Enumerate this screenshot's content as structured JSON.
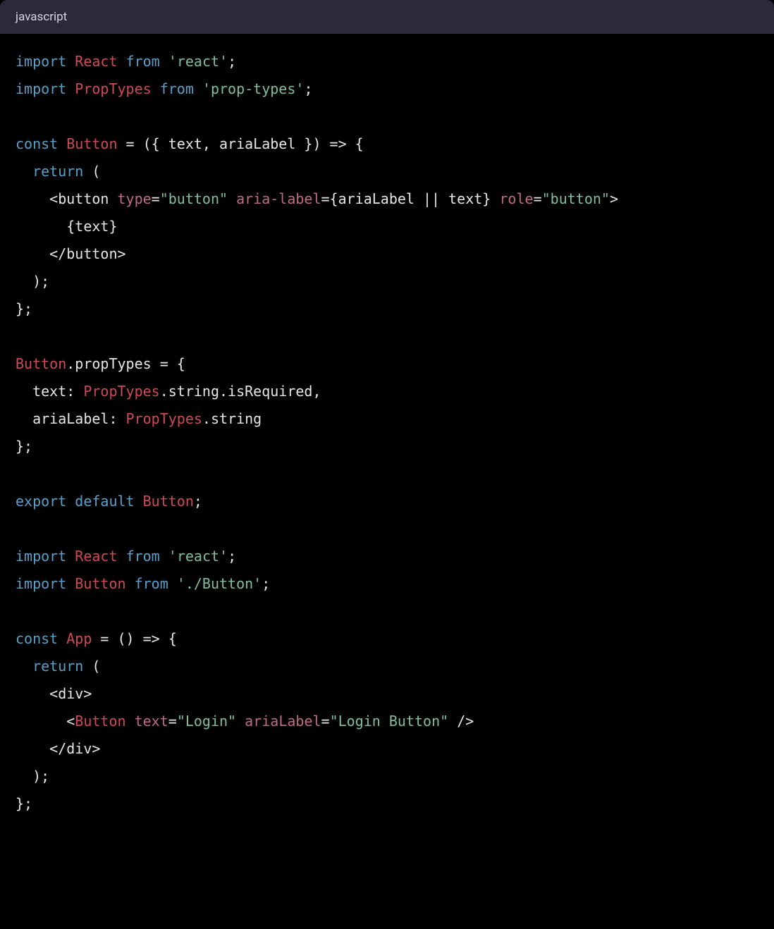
{
  "header": {
    "language": "javascript"
  },
  "code": {
    "lines": [
      [
        {
          "t": "import ",
          "c": "tok-kw"
        },
        {
          "t": "React",
          "c": "tok-type"
        },
        {
          "t": " ",
          "c": "tok-plain"
        },
        {
          "t": "from",
          "c": "tok-kw"
        },
        {
          "t": " ",
          "c": "tok-plain"
        },
        {
          "t": "'react'",
          "c": "tok-str"
        },
        {
          "t": ";",
          "c": "tok-punc"
        }
      ],
      [
        {
          "t": "import ",
          "c": "tok-kw"
        },
        {
          "t": "PropTypes",
          "c": "tok-type"
        },
        {
          "t": " ",
          "c": "tok-plain"
        },
        {
          "t": "from",
          "c": "tok-kw"
        },
        {
          "t": " ",
          "c": "tok-plain"
        },
        {
          "t": "'prop-types'",
          "c": "tok-str"
        },
        {
          "t": ";",
          "c": "tok-punc"
        }
      ],
      [],
      [
        {
          "t": "const ",
          "c": "tok-kw"
        },
        {
          "t": "Button",
          "c": "tok-type"
        },
        {
          "t": " = ({ text, ariaLabel }) => {",
          "c": "tok-plain"
        }
      ],
      [
        {
          "t": "  ",
          "c": "tok-plain"
        },
        {
          "t": "return",
          "c": "tok-kw"
        },
        {
          "t": " (",
          "c": "tok-plain"
        }
      ],
      [
        {
          "t": "    <button ",
          "c": "tok-plain"
        },
        {
          "t": "type",
          "c": "tok-attr"
        },
        {
          "t": "=",
          "c": "tok-plain"
        },
        {
          "t": "\"button\"",
          "c": "tok-str"
        },
        {
          "t": " ",
          "c": "tok-plain"
        },
        {
          "t": "aria-label",
          "c": "tok-attr"
        },
        {
          "t": "={ariaLabel || text} ",
          "c": "tok-plain"
        },
        {
          "t": "role",
          "c": "tok-attr"
        },
        {
          "t": "=",
          "c": "tok-plain"
        },
        {
          "t": "\"button\"",
          "c": "tok-str"
        },
        {
          "t": ">",
          "c": "tok-plain"
        }
      ],
      [
        {
          "t": "      {text}",
          "c": "tok-plain"
        }
      ],
      [
        {
          "t": "    </button>",
          "c": "tok-plain"
        }
      ],
      [
        {
          "t": "  );",
          "c": "tok-plain"
        }
      ],
      [
        {
          "t": "};",
          "c": "tok-plain"
        }
      ],
      [],
      [
        {
          "t": "Button",
          "c": "tok-type"
        },
        {
          "t": ".propTypes = {",
          "c": "tok-plain"
        }
      ],
      [
        {
          "t": "  text: ",
          "c": "tok-plain"
        },
        {
          "t": "PropTypes",
          "c": "tok-type"
        },
        {
          "t": ".string.isRequired,",
          "c": "tok-plain"
        }
      ],
      [
        {
          "t": "  ariaLabel: ",
          "c": "tok-plain"
        },
        {
          "t": "PropTypes",
          "c": "tok-type"
        },
        {
          "t": ".string",
          "c": "tok-plain"
        }
      ],
      [
        {
          "t": "};",
          "c": "tok-plain"
        }
      ],
      [],
      [
        {
          "t": "export default ",
          "c": "tok-kw"
        },
        {
          "t": "Button",
          "c": "tok-type"
        },
        {
          "t": ";",
          "c": "tok-punc"
        }
      ],
      [],
      [
        {
          "t": "import ",
          "c": "tok-kw"
        },
        {
          "t": "React",
          "c": "tok-type"
        },
        {
          "t": " ",
          "c": "tok-plain"
        },
        {
          "t": "from",
          "c": "tok-kw"
        },
        {
          "t": " ",
          "c": "tok-plain"
        },
        {
          "t": "'react'",
          "c": "tok-str"
        },
        {
          "t": ";",
          "c": "tok-punc"
        }
      ],
      [
        {
          "t": "import ",
          "c": "tok-kw"
        },
        {
          "t": "Button",
          "c": "tok-type"
        },
        {
          "t": " ",
          "c": "tok-plain"
        },
        {
          "t": "from",
          "c": "tok-kw"
        },
        {
          "t": " ",
          "c": "tok-plain"
        },
        {
          "t": "'./Button'",
          "c": "tok-str"
        },
        {
          "t": ";",
          "c": "tok-punc"
        }
      ],
      [],
      [
        {
          "t": "const ",
          "c": "tok-kw"
        },
        {
          "t": "App",
          "c": "tok-type"
        },
        {
          "t": " = () => {",
          "c": "tok-plain"
        }
      ],
      [
        {
          "t": "  ",
          "c": "tok-plain"
        },
        {
          "t": "return",
          "c": "tok-kw"
        },
        {
          "t": " (",
          "c": "tok-plain"
        }
      ],
      [
        {
          "t": "    <div>",
          "c": "tok-plain"
        }
      ],
      [
        {
          "t": "      <",
          "c": "tok-plain"
        },
        {
          "t": "Button",
          "c": "tok-type"
        },
        {
          "t": " ",
          "c": "tok-plain"
        },
        {
          "t": "text",
          "c": "tok-attr"
        },
        {
          "t": "=",
          "c": "tok-plain"
        },
        {
          "t": "\"Login\"",
          "c": "tok-str"
        },
        {
          "t": " ",
          "c": "tok-plain"
        },
        {
          "t": "ariaLabel",
          "c": "tok-attr"
        },
        {
          "t": "=",
          "c": "tok-plain"
        },
        {
          "t": "\"Login Button\"",
          "c": "tok-str"
        },
        {
          "t": " />",
          "c": "tok-plain"
        }
      ],
      [
        {
          "t": "    </div>",
          "c": "tok-plain"
        }
      ],
      [
        {
          "t": "  );",
          "c": "tok-plain"
        }
      ],
      [
        {
          "t": "};",
          "c": "tok-plain"
        }
      ]
    ]
  }
}
